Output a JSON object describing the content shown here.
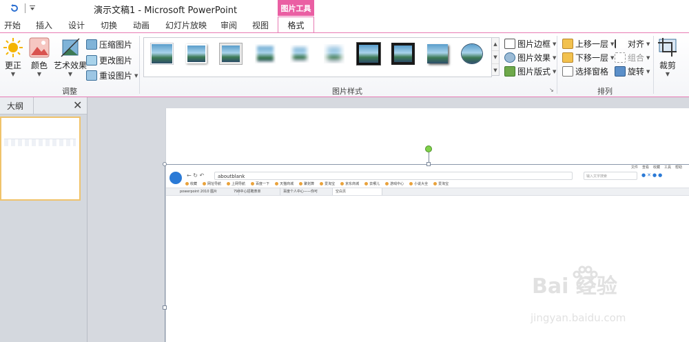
{
  "window": {
    "title": "演示文稿1 - Microsoft PowerPoint",
    "context_tab_title": "图片工具"
  },
  "ribbon_tabs": [
    "开始",
    "插入",
    "设计",
    "切换",
    "动画",
    "幻灯片放映",
    "审阅",
    "视图",
    "格式"
  ],
  "active_tab": "格式",
  "groups": {
    "adjust": {
      "label": "调整",
      "corrections": "更正",
      "color": "颜色",
      "artistic": "艺术效果",
      "compress": "压缩图片",
      "change": "更改图片",
      "reset": "重设图片"
    },
    "picture_styles": {
      "label": "图片样式",
      "border": "图片边框",
      "effects": "图片效果",
      "layout": "图片版式"
    },
    "arrange": {
      "label": "排列",
      "bring_forward": "上移一层",
      "send_backward": "下移一层",
      "selection_pane": "选择窗格",
      "align": "对齐",
      "group": "组合",
      "rotate": "旋转"
    },
    "size": {
      "crop": "裁剪"
    }
  },
  "left_panel": {
    "tab_outline": "大纲",
    "close": "✕"
  },
  "embedded_browser": {
    "menu": [
      "文件",
      "查看",
      "收藏",
      "工具",
      "帮助"
    ],
    "url": "aboutblank",
    "search_placeholder": "输入文字搜索",
    "favorites": [
      "收藏",
      "网址导航",
      "上网导航",
      "百度一下",
      "天猫商城",
      "聚划算",
      "爱淘宝",
      "京东商城",
      "去哪儿",
      "游戏中心",
      "小说大全",
      "爱淘宝"
    ],
    "tabs": [
      "powerpoint 2010 图片",
      "798中心招聘表单",
      "百度个人中心——你可",
      "空白页"
    ]
  },
  "watermark": {
    "logo": "Bai 经验",
    "url": "jingyan.baidu.com"
  }
}
